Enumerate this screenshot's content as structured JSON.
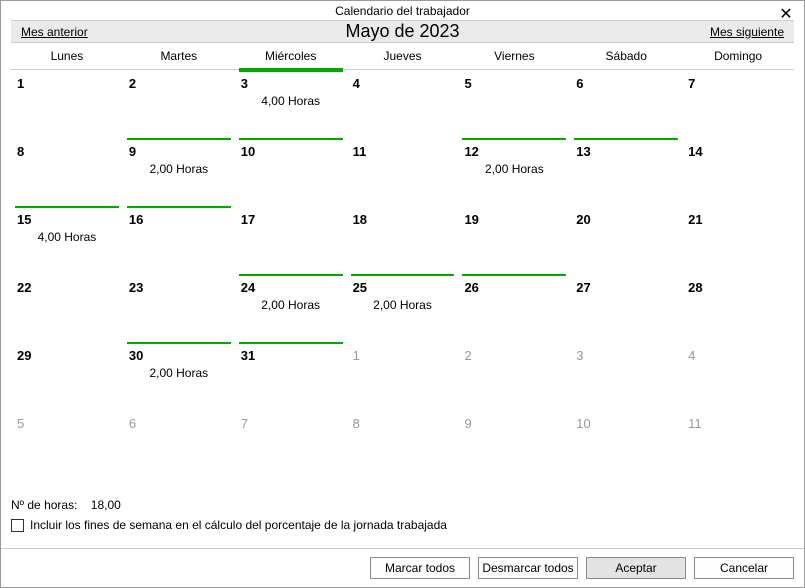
{
  "title": "Calendario del trabajador",
  "nav": {
    "prev": "Mes anterior",
    "next": "Mes siguiente",
    "month": "Mayo de 2023"
  },
  "dow": [
    {
      "label": "Lunes",
      "marked": false
    },
    {
      "label": "Martes",
      "marked": false
    },
    {
      "label": "Miércoles",
      "marked": true
    },
    {
      "label": "Jueves",
      "marked": false
    },
    {
      "label": "Viernes",
      "marked": false
    },
    {
      "label": "Sábado",
      "marked": false
    },
    {
      "label": "Domingo",
      "marked": false
    }
  ],
  "weeks": [
    [
      {
        "n": "1",
        "other": false,
        "mark": false,
        "hours": ""
      },
      {
        "n": "2",
        "other": false,
        "mark": false,
        "hours": ""
      },
      {
        "n": "3",
        "other": false,
        "mark": true,
        "hours": "4,00 Horas"
      },
      {
        "n": "4",
        "other": false,
        "mark": false,
        "hours": ""
      },
      {
        "n": "5",
        "other": false,
        "mark": false,
        "hours": ""
      },
      {
        "n": "6",
        "other": false,
        "mark": false,
        "hours": ""
      },
      {
        "n": "7",
        "other": false,
        "mark": false,
        "hours": ""
      }
    ],
    [
      {
        "n": "8",
        "other": false,
        "mark": false,
        "hours": ""
      },
      {
        "n": "9",
        "other": false,
        "mark": true,
        "hours": "2,00 Horas"
      },
      {
        "n": "10",
        "other": false,
        "mark": true,
        "hours": ""
      },
      {
        "n": "11",
        "other": false,
        "mark": false,
        "hours": ""
      },
      {
        "n": "12",
        "other": false,
        "mark": true,
        "hours": "2,00 Horas"
      },
      {
        "n": "13",
        "other": false,
        "mark": true,
        "hours": ""
      },
      {
        "n": "14",
        "other": false,
        "mark": false,
        "hours": ""
      }
    ],
    [
      {
        "n": "15",
        "other": false,
        "mark": true,
        "hours": "4,00 Horas"
      },
      {
        "n": "16",
        "other": false,
        "mark": true,
        "hours": ""
      },
      {
        "n": "17",
        "other": false,
        "mark": false,
        "hours": ""
      },
      {
        "n": "18",
        "other": false,
        "mark": false,
        "hours": ""
      },
      {
        "n": "19",
        "other": false,
        "mark": false,
        "hours": ""
      },
      {
        "n": "20",
        "other": false,
        "mark": false,
        "hours": ""
      },
      {
        "n": "21",
        "other": false,
        "mark": false,
        "hours": ""
      }
    ],
    [
      {
        "n": "22",
        "other": false,
        "mark": false,
        "hours": ""
      },
      {
        "n": "23",
        "other": false,
        "mark": false,
        "hours": ""
      },
      {
        "n": "24",
        "other": false,
        "mark": true,
        "hours": "2,00 Horas"
      },
      {
        "n": "25",
        "other": false,
        "mark": true,
        "hours": "2,00 Horas"
      },
      {
        "n": "26",
        "other": false,
        "mark": true,
        "hours": ""
      },
      {
        "n": "27",
        "other": false,
        "mark": false,
        "hours": ""
      },
      {
        "n": "28",
        "other": false,
        "mark": false,
        "hours": ""
      }
    ],
    [
      {
        "n": "29",
        "other": false,
        "mark": false,
        "hours": ""
      },
      {
        "n": "30",
        "other": false,
        "mark": true,
        "hours": "2,00 Horas"
      },
      {
        "n": "31",
        "other": false,
        "mark": true,
        "hours": ""
      },
      {
        "n": "1",
        "other": true,
        "mark": false,
        "hours": ""
      },
      {
        "n": "2",
        "other": true,
        "mark": false,
        "hours": ""
      },
      {
        "n": "3",
        "other": true,
        "mark": false,
        "hours": ""
      },
      {
        "n": "4",
        "other": true,
        "mark": false,
        "hours": ""
      }
    ],
    [
      {
        "n": "5",
        "other": true,
        "mark": false,
        "hours": ""
      },
      {
        "n": "6",
        "other": true,
        "mark": false,
        "hours": ""
      },
      {
        "n": "7",
        "other": true,
        "mark": false,
        "hours": ""
      },
      {
        "n": "8",
        "other": true,
        "mark": false,
        "hours": ""
      },
      {
        "n": "9",
        "other": true,
        "mark": false,
        "hours": ""
      },
      {
        "n": "10",
        "other": true,
        "mark": false,
        "hours": ""
      },
      {
        "n": "11",
        "other": true,
        "mark": false,
        "hours": ""
      }
    ]
  ],
  "total": {
    "label": "Nº de horas:",
    "value": "18,00"
  },
  "weekend_check": {
    "label": "Incluir los fines de semana en el cálculo del porcentaje de la jornada trabajada",
    "checked": false
  },
  "buttons": {
    "mark_all": "Marcar todos",
    "unmark_all": "Desmarcar todos",
    "ok": "Aceptar",
    "cancel": "Cancelar"
  }
}
